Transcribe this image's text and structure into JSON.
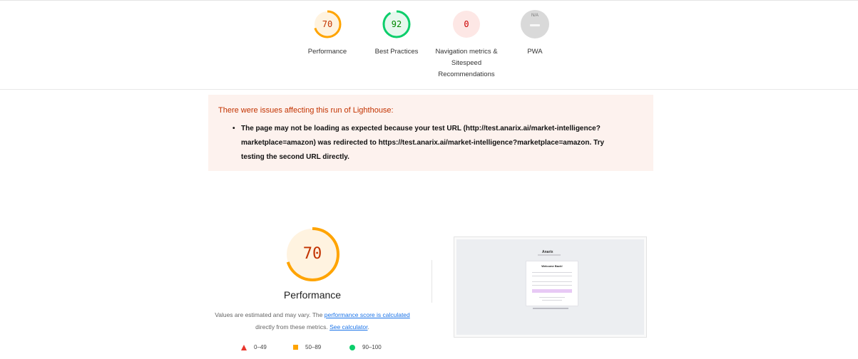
{
  "gauges": [
    {
      "label": "Performance",
      "score": "70",
      "value": 70,
      "ring_color": "#ffa400",
      "text_color": "#c33300"
    },
    {
      "label": "Best Practices",
      "score": "92",
      "value": 92,
      "ring_color": "#0cce6b",
      "text_color": "#008800"
    },
    {
      "label": "Navigation metrics & Sitespeed Recommendations",
      "score": "0",
      "value": 0,
      "ring_color": "#e8362c",
      "text_color": "#cc0000"
    },
    {
      "label": "PWA",
      "score": "N/A"
    }
  ],
  "warning": {
    "title": "There were issues affecting this run of Lighthouse:",
    "items": [
      "The page may not be loading as expected because your test URL (http://test.anarix.ai/market-intelligence?marketplace=amazon) was redirected to https://test.anarix.ai/market-intelligence?marketplace=amazon. Try testing the second URL directly."
    ]
  },
  "performance": {
    "score": "70",
    "value": 70,
    "title": "Performance",
    "desc_prefix": "Values are estimated and may vary. The ",
    "link_score": "performance score is calculated",
    "desc_middle": " directly from these metrics. ",
    "link_calc": "See calculator",
    "desc_suffix": "."
  },
  "legend": [
    {
      "range": "0–49",
      "color": "#e8362c",
      "shape": "triangle"
    },
    {
      "range": "50–89",
      "color": "#ffa400",
      "shape": "square"
    },
    {
      "range": "90–100",
      "color": "#0cce6b",
      "shape": "circle"
    }
  ],
  "screenshot": {
    "logo": "Anarix",
    "card_title": "Welcome Back!"
  }
}
